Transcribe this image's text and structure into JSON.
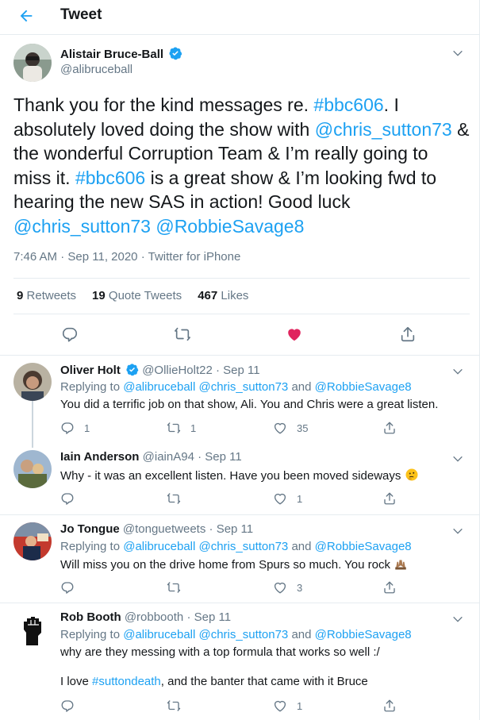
{
  "header": {
    "title": "Tweet",
    "back_icon": "arrow-left-icon"
  },
  "tweet": {
    "author_name": "Alistair Bruce-Ball",
    "author_handle": "@alibruceball",
    "text_parts": [
      {
        "t": "Thank you for the kind messages re. ",
        "link": false
      },
      {
        "t": "#bbc606",
        "link": true
      },
      {
        "t": ". I absolutely loved doing the show with ",
        "link": false
      },
      {
        "t": "@chris_sutton73",
        "link": true
      },
      {
        "t": " & the wonderful Corruption Team & I’m really going to miss it. ",
        "link": false
      },
      {
        "t": "#bbc606",
        "link": true
      },
      {
        "t": " is a great show & I’m looking fwd to hearing the new SAS in action! Good luck ",
        "link": false
      },
      {
        "t": "@chris_sutton73",
        "link": true
      },
      {
        "t": " ",
        "link": false
      },
      {
        "t": "@RobbieSavage8",
        "link": true
      }
    ],
    "time": "7:46 AM",
    "date": "Sep 11, 2020",
    "source": "Twitter for iPhone",
    "separator": "·",
    "retweets_count": "9",
    "retweets_label": "Retweets",
    "quote_count": "19",
    "quote_label": "Quote Tweets",
    "likes_count": "467",
    "likes_label": "Likes"
  },
  "replies": [
    {
      "name": "Oliver Holt",
      "handle": "@OllieHolt22",
      "verified": true,
      "date": "Sep 11",
      "replying_label": "Replying to",
      "replying_to": "@alibruceball @chris_sutton73",
      "and_label": "and",
      "replying_last": "@RobbieSavage8",
      "text": "You did a terrific job on that show, Ali. You and Chris were a great listen.",
      "reply_count": "1",
      "retweet_count": "1",
      "like_count": "35"
    },
    {
      "name": "Iain Anderson",
      "handle": "@iainA94",
      "verified": false,
      "date": "Sep 11",
      "text": "Why - it was an excellent listen. Have you been moved sideways",
      "emoji": "thinking-face-emoji",
      "reply_count": "",
      "retweet_count": "",
      "like_count": "1"
    },
    {
      "name": "Jo Tongue",
      "handle": "@tonguetweets",
      "verified": false,
      "date": "Sep 11",
      "replying_label": "Replying to",
      "replying_to": "@alibruceball @chris_sutton73",
      "and_label": "and",
      "replying_last": "@RobbieSavage8",
      "text": "Will miss you on the drive home from Spurs so much. You rock",
      "emoji": "raising-hands-emoji",
      "reply_count": "",
      "retweet_count": "",
      "like_count": "3"
    },
    {
      "name": "Rob Booth",
      "handle": "@robbooth",
      "verified": false,
      "date": "Sep 11",
      "replying_label": "Replying to",
      "replying_to": "@alibruceball @chris_sutton73",
      "and_label": "and",
      "replying_last": "@RobbieSavage8",
      "text": "why are they messing with a top formula that works so well  :/",
      "text2_prefix": "I love ",
      "text2_link": "#suttondeath",
      "text2_suffix": ", and the banter that came with it Bruce",
      "reply_count": "",
      "retweet_count": "",
      "like_count": "1"
    }
  ],
  "colors": {
    "accent": "#1da1f2",
    "like": "#e0245e",
    "muted": "#657786",
    "border": "#e6ecf0"
  }
}
